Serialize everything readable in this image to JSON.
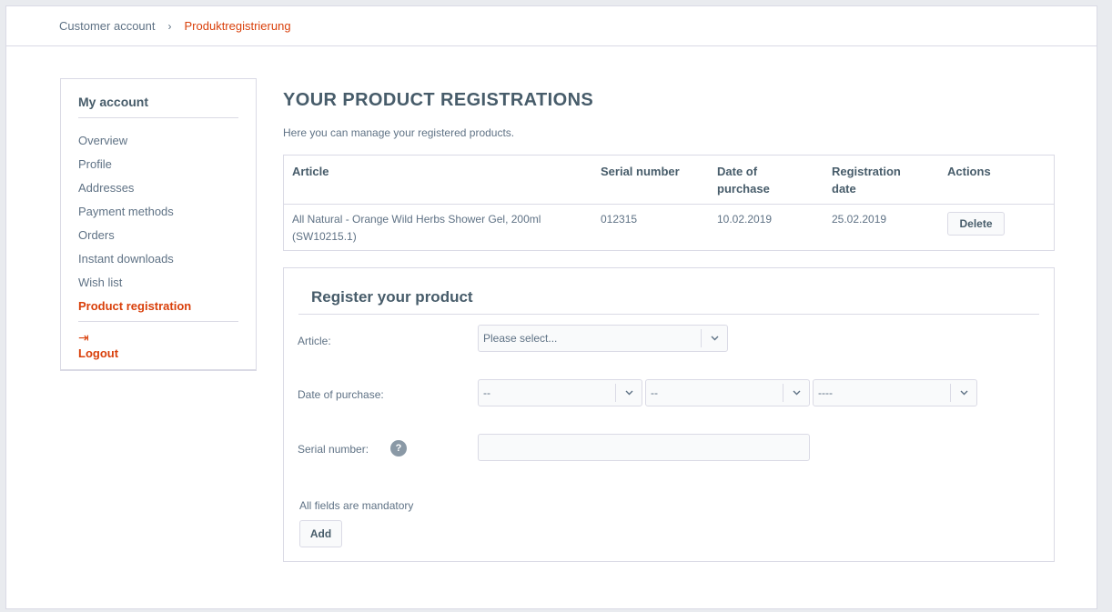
{
  "breadcrumb": {
    "items": [
      "Customer account",
      "Produktregistrierung"
    ],
    "separator": "›"
  },
  "sidebar": {
    "title": "My account",
    "items": [
      {
        "label": "Overview"
      },
      {
        "label": "Profile"
      },
      {
        "label": "Addresses"
      },
      {
        "label": "Payment methods"
      },
      {
        "label": "Orders"
      },
      {
        "label": "Instant downloads"
      },
      {
        "label": "Wish list"
      },
      {
        "label": "Product registration",
        "active": true
      }
    ],
    "logout": {
      "icon": "logout-icon",
      "glyph": "⇥",
      "label": "Logout"
    }
  },
  "main": {
    "title": "YOUR PRODUCT REGISTRATIONS",
    "description": "Here you can manage your registered products.",
    "table": {
      "headers": {
        "article": "Article",
        "serial": "Serial number",
        "purchase_line1": "Date of",
        "purchase_line2": "purchase",
        "registration_line1": "Registration",
        "registration_line2": "date",
        "actions": "Actions"
      },
      "rows": [
        {
          "article_line1": "All Natural - Orange Wild Herbs Shower Gel, 200ml",
          "article_line2": "(SW10215.1)",
          "serial": "012315",
          "purchase_date": "10.02.2019",
          "registration_date": "25.02.2019",
          "action": "Delete"
        }
      ]
    }
  },
  "form": {
    "title": "Register your product",
    "article_label": "Article:",
    "article_placeholder": "Please select...",
    "date_label": "Date of purchase:",
    "day_placeholder": "--",
    "month_placeholder": "--",
    "year_placeholder": "----",
    "serial_label": "Serial number:",
    "help_glyph": "?",
    "mandatory_note": "All fields are mandatory",
    "add_label": "Add"
  },
  "colors": {
    "accent": "#d9400b",
    "text": "#5f7285",
    "heading": "#475c6a",
    "border": "#dadae5"
  }
}
